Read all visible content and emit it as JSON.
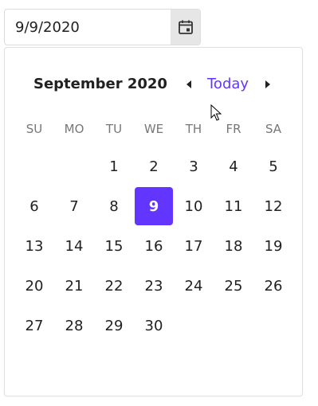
{
  "input": {
    "value": "9/9/2020"
  },
  "icons": {
    "calendar": "calendar-icon",
    "prev": "caret-left-icon",
    "next": "caret-right-icon",
    "cursor": "mouse-pointer-icon"
  },
  "calendar": {
    "month_title": "September 2020",
    "today_label": "Today",
    "weekdays": [
      "SU",
      "MO",
      "TU",
      "WE",
      "TH",
      "FR",
      "SA"
    ],
    "leading_blanks": 2,
    "days": [
      "1",
      "2",
      "3",
      "4",
      "5",
      "6",
      "7",
      "8",
      "9",
      "10",
      "11",
      "12",
      "13",
      "14",
      "15",
      "16",
      "17",
      "18",
      "19",
      "20",
      "21",
      "22",
      "23",
      "24",
      "25",
      "26",
      "27",
      "28",
      "29",
      "30"
    ],
    "selected_day": "9"
  },
  "colors": {
    "accent": "#6236ff",
    "icon_bg": "#e6e6e6",
    "weekday_text": "#777777"
  }
}
